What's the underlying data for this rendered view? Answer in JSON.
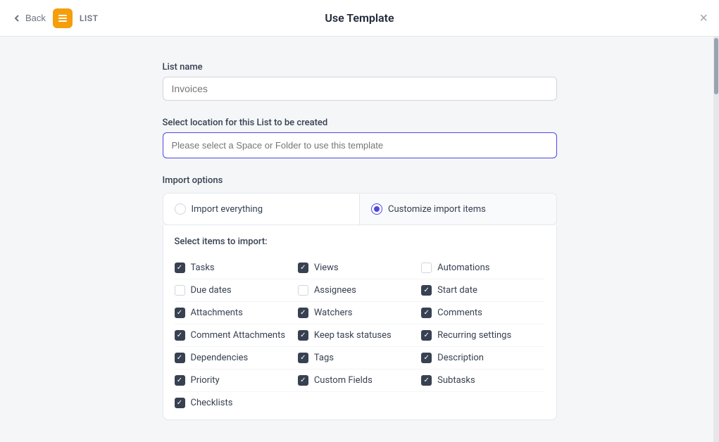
{
  "topbar": {
    "back_label": "Back",
    "list_label": "LIST",
    "title": "Use Template",
    "close_label": "×"
  },
  "form": {
    "list_name_label": "List name",
    "list_name_placeholder": "Invoices",
    "location_label": "Select location for this List to be created",
    "location_placeholder": "Please select a Space or Folder to use this template",
    "import_options_label": "Import options",
    "import_everything_label": "Import everything",
    "customize_import_label": "Customize import items",
    "select_items_label": "Select items to import:",
    "items": [
      {
        "col": 0,
        "row": 0,
        "label": "Tasks",
        "checked": true
      },
      {
        "col": 1,
        "row": 0,
        "label": "Views",
        "checked": true
      },
      {
        "col": 2,
        "row": 0,
        "label": "Automations",
        "checked": false
      },
      {
        "col": 0,
        "row": 1,
        "label": "Due dates",
        "checked": false
      },
      {
        "col": 1,
        "row": 1,
        "label": "Assignees",
        "checked": false
      },
      {
        "col": 2,
        "row": 1,
        "label": "Start date",
        "checked": true
      },
      {
        "col": 0,
        "row": 2,
        "label": "Attachments",
        "checked": true
      },
      {
        "col": 1,
        "row": 2,
        "label": "Watchers",
        "checked": true
      },
      {
        "col": 2,
        "row": 2,
        "label": "Comments",
        "checked": true
      },
      {
        "col": 0,
        "row": 3,
        "label": "Comment Attachments",
        "checked": true
      },
      {
        "col": 1,
        "row": 3,
        "label": "Keep task statuses",
        "checked": true
      },
      {
        "col": 2,
        "row": 3,
        "label": "Recurring settings",
        "checked": true
      },
      {
        "col": 0,
        "row": 4,
        "label": "Dependencies",
        "checked": true
      },
      {
        "col": 1,
        "row": 4,
        "label": "Tags",
        "checked": true
      },
      {
        "col": 2,
        "row": 4,
        "label": "Description",
        "checked": true
      },
      {
        "col": 0,
        "row": 5,
        "label": "Priority",
        "checked": true
      },
      {
        "col": 1,
        "row": 5,
        "label": "Custom Fields",
        "checked": true
      },
      {
        "col": 2,
        "row": 5,
        "label": "Subtasks",
        "checked": true
      },
      {
        "col": 0,
        "row": 6,
        "label": "Checklists",
        "checked": true
      }
    ]
  }
}
